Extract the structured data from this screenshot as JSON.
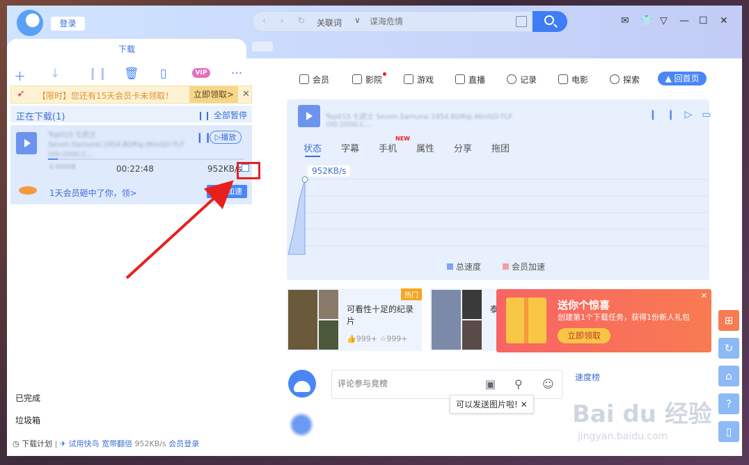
{
  "header": {
    "login": "登录",
    "search_mode": "关联词",
    "search_placeholder": "谍海危情"
  },
  "left": {
    "tab_label": "下载",
    "vip_icon": "VIP",
    "promo_text": "【限时】您还有15天会员卡未领取！",
    "promo_button": "立即领取>",
    "downloading_title": "正在下载(1)",
    "pause_all": "全部暂停",
    "item": {
      "name": "Top015 七武士 Seven.Samurai.1954.BDRip.MiniSD-TLF (00:2000.C...",
      "play": "播放",
      "size_blur": "0.0000B",
      "remaining": "00:22:48",
      "speed": "952KB/s",
      "progress": 0.05,
      "gift_text": "1天会员砸中了你，领>",
      "accel_button": "超级加速"
    },
    "completed": "已完成",
    "trash": "垃圾箱",
    "footer": {
      "plan": "下载计划",
      "trial": "试用快鸟 宽带翻倍",
      "speed": "952KB/s",
      "member_login": "会员登录"
    }
  },
  "nav": {
    "items": [
      "会员",
      "影院",
      "游戏",
      "直播",
      "记录",
      "电影",
      "探索"
    ],
    "home": "回首页"
  },
  "chart": {
    "file_name": "Top015 七武士 Seven.Samurai.1954.BDRip.MiniSD-TLF (00:2000.C...",
    "tabs": [
      "状态",
      "字幕",
      "手机",
      "属性",
      "分享",
      "拖团"
    ],
    "new_badge": "NEW",
    "speed_label": "952KB/s",
    "legend_total": "总速度",
    "legend_member": "会员加速",
    "color_total": "#7aa5f2",
    "color_member": "#f4a0a0"
  },
  "chart_data": {
    "type": "area",
    "title": "",
    "series": [
      {
        "name": "总速度",
        "values": [
          0,
          300,
          700,
          952
        ]
      },
      {
        "name": "会员加速",
        "values": [
          0,
          0,
          0,
          0
        ]
      }
    ],
    "x": [
      0,
      1,
      2,
      3
    ],
    "ylim": [
      0,
      1000
    ]
  },
  "cards": [
    {
      "title": "可看性十足的纪录片",
      "likes": "999+",
      "favs": "999+",
      "tag": "热门"
    },
    {
      "title": "泰泰",
      "tag": ""
    }
  ],
  "gift_popup": {
    "title": "送你个惊喜",
    "desc": "创建第1个下载任务，获得1份新人礼包",
    "button": "立即领取"
  },
  "comment": {
    "placeholder": "评论参与竞榜",
    "tooltip": "可以发送图片啦!",
    "rank_title": "速度榜"
  },
  "watermark": {
    "text": "Bai du 经验",
    "url": "jingyan.baidu.com"
  }
}
